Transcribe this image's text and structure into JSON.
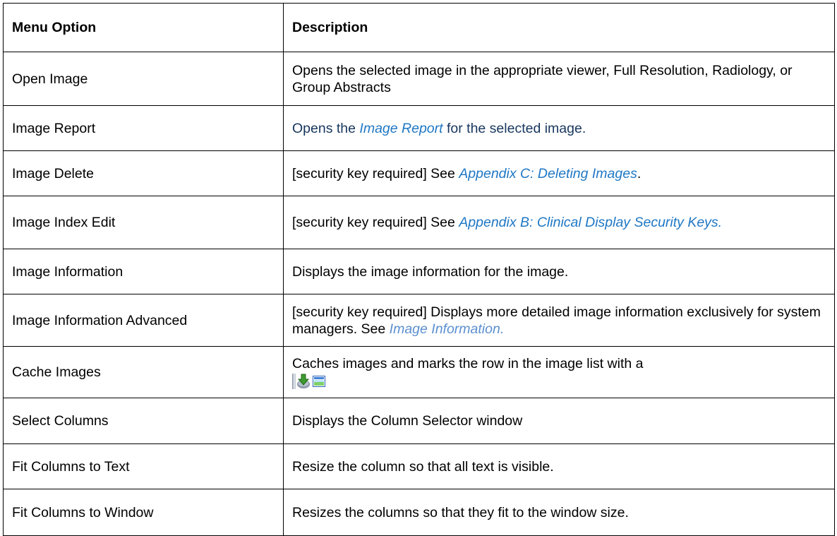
{
  "table": {
    "headers": [
      "Menu Option",
      "Description"
    ],
    "rows": [
      {
        "option": "Open Image",
        "description": "Opens the selected image in the appropriate viewer, Full Resolution, Radiology, or Group Abstracts"
      },
      {
        "option": "Image Report",
        "desc_prefix": "Opens the ",
        "desc_link": "Image Report",
        "desc_suffix": " for the selected image."
      },
      {
        "option": "Image Delete",
        "desc_prefix": "[security key required] See ",
        "desc_link": "Appendix C: Deleting Images",
        "desc_suffix": "."
      },
      {
        "option": "Image Index Edit",
        "desc_prefix": "[security key required] See ",
        "desc_link": "Appendix B: Clinical Display Security Keys."
      },
      {
        "option": "Image Information",
        "description": "Displays the image information for the image."
      },
      {
        "option": "Image Information Advanced",
        "desc_prefix": "[security key required] Displays more detailed image information exclusively for system managers. See ",
        "desc_link": "Image Information."
      },
      {
        "option": "Cache Images",
        "description": "Caches images and marks the row in the image list with a",
        "icons": [
          "cache-download-icon",
          "image-thumbnail-icon"
        ]
      },
      {
        "option": "Select Columns",
        "description": "Displays the Column Selector window"
      },
      {
        "option": "Fit Columns to Text",
        "description": "Resize the column so that all text is visible."
      },
      {
        "option": "Fit Columns to Window",
        "description": "Resizes the columns so that they fit to the window size."
      }
    ]
  }
}
